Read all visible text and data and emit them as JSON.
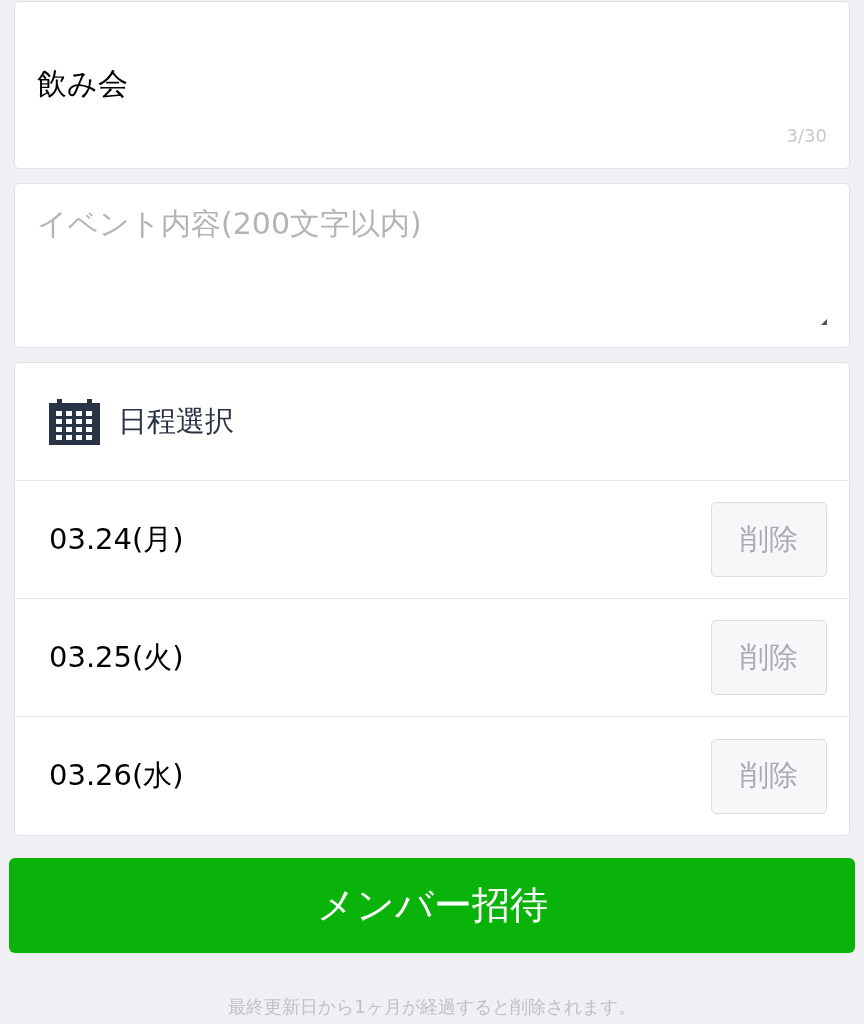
{
  "title_field": {
    "value": "飲み会",
    "counter": "3/30"
  },
  "description_field": {
    "placeholder": "イベント内容(200文字以内)"
  },
  "schedule": {
    "heading": "日程選択",
    "dates": [
      {
        "label": "03.24(月)",
        "action": "削除"
      },
      {
        "label": "03.25(火)",
        "action": "削除"
      },
      {
        "label": "03.26(水)",
        "action": "削除"
      }
    ]
  },
  "invite_button": "メンバー招待",
  "footer_note": "最終更新日から1ヶ月が経過すると削除されます。"
}
